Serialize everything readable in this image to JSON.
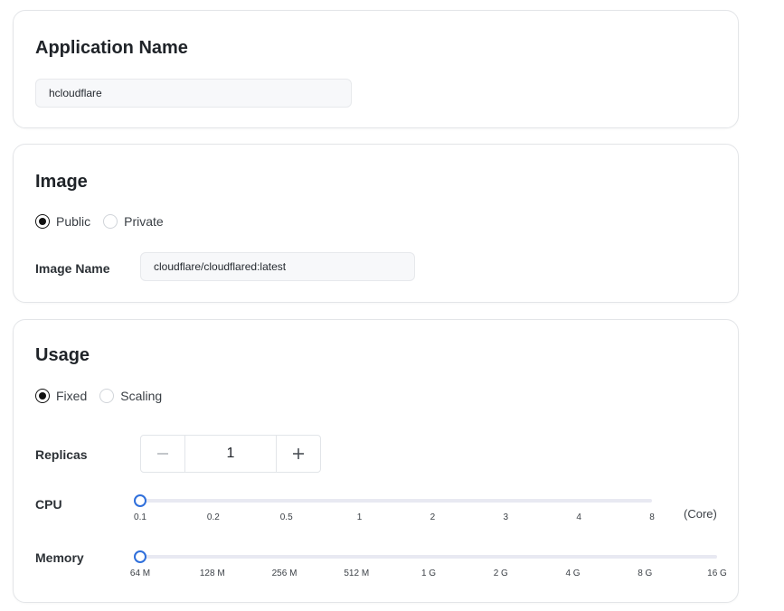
{
  "app_card": {
    "title": "Application Name",
    "input_value": "hcloudflare"
  },
  "image_card": {
    "title": "Image",
    "radios": [
      {
        "label": "Public",
        "checked": true
      },
      {
        "label": "Private",
        "checked": false
      }
    ],
    "image_name_label": "Image Name",
    "image_name_value": "cloudflare/cloudflared:latest"
  },
  "usage_card": {
    "title": "Usage",
    "radios": [
      {
        "label": "Fixed",
        "checked": true
      },
      {
        "label": "Scaling",
        "checked": false
      }
    ],
    "replicas_label": "Replicas",
    "replicas_value": "1",
    "replicas_minus_icon": "minus-icon",
    "replicas_plus_icon": "plus-icon",
    "cpu_label": "CPU",
    "cpu_ticks": [
      "0.1",
      "0.2",
      "0.5",
      "1",
      "2",
      "3",
      "4",
      "8"
    ],
    "cpu_selected": "0.1",
    "cpu_unit": "(Core)",
    "memory_label": "Memory",
    "memory_ticks": [
      "64 M",
      "128 M",
      "256 M",
      "512 M",
      "1 G",
      "2 G",
      "4 G",
      "8 G",
      "16 G"
    ],
    "memory_selected": "64 M"
  },
  "colors": {
    "accent": "#2f6fdb",
    "track": "#e8e9f2",
    "border": "#e3e5e8"
  }
}
